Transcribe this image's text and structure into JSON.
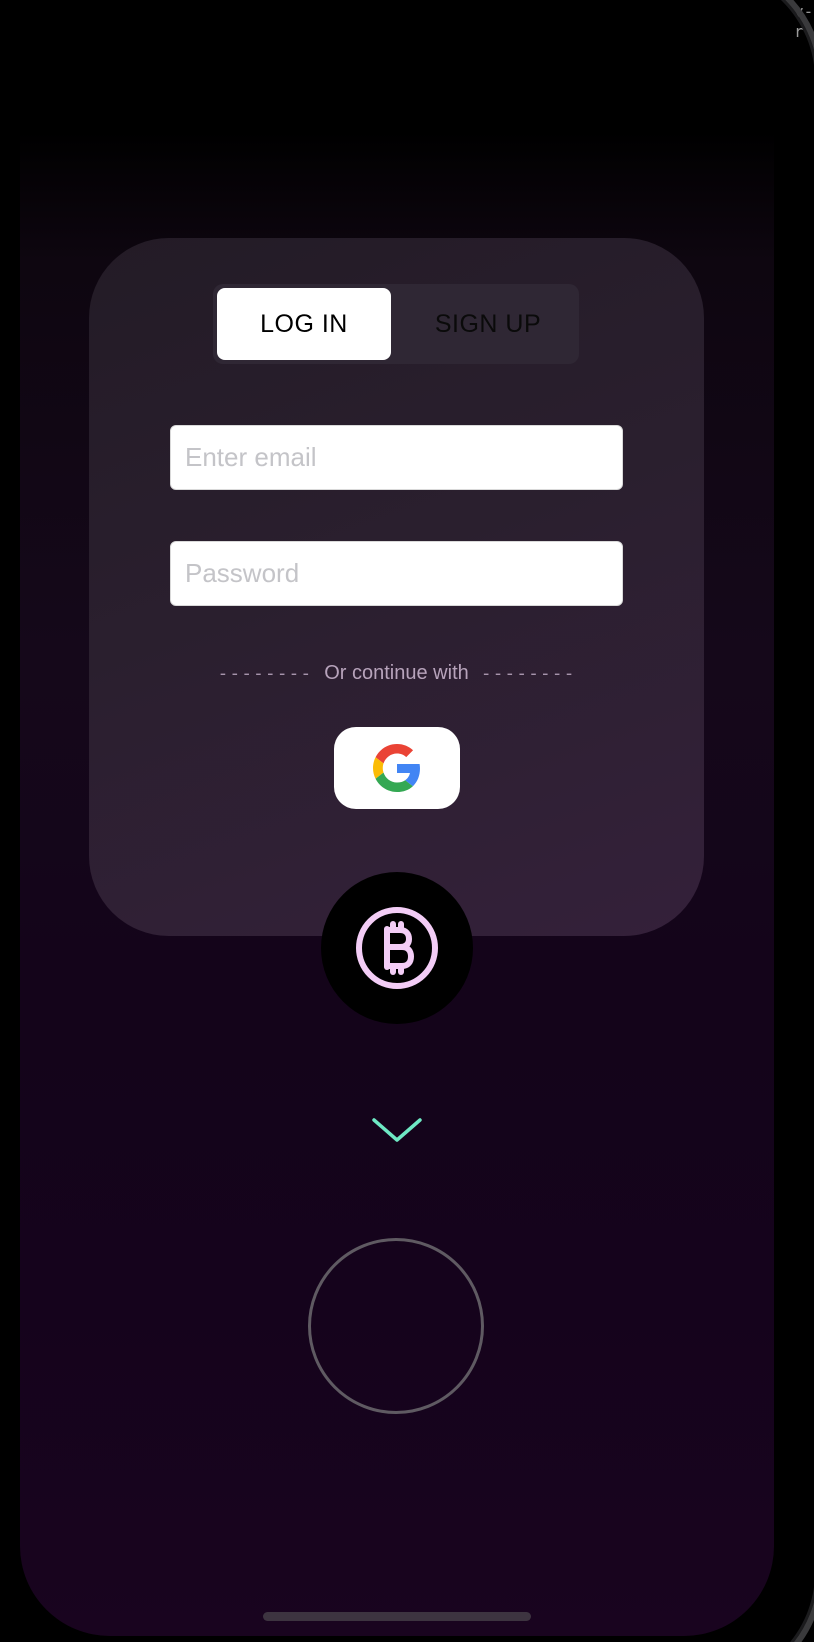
{
  "overlay": {
    "corner_text": "v-\nr"
  },
  "auth": {
    "tabs": [
      {
        "label": "LOG IN",
        "active": true
      },
      {
        "label": "SIGN UP",
        "active": false
      }
    ],
    "email": {
      "placeholder": "Enter email",
      "value": ""
    },
    "password": {
      "placeholder": "Password",
      "value": ""
    },
    "divider": {
      "left_dashes": "--------",
      "text": "Or continue with",
      "right_dashes": "--------"
    },
    "google_button": {
      "icon": "google-logo-icon"
    }
  },
  "badge": {
    "icon": "bitcoin-icon",
    "color": "#f3cdf6"
  },
  "chevron": {
    "icon": "chevron-down-icon",
    "color": "#6ee9c4"
  },
  "colors": {
    "card_top": "#231b26",
    "card_bottom": "#34203a",
    "background_bottom": "#19041f",
    "ring": "#5f5a62"
  }
}
